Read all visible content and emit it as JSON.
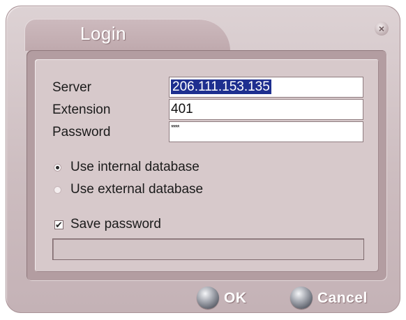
{
  "window": {
    "title": "Login",
    "close_icon": "close-icon"
  },
  "form": {
    "server_label": "Server",
    "server_value": "206.111.153.135",
    "extension_label": "Extension",
    "extension_value": "401",
    "password_label": "Password",
    "password_masked": "****"
  },
  "database": {
    "options": [
      {
        "label": "Use internal database",
        "selected": true
      },
      {
        "label": "Use external database",
        "selected": false
      }
    ]
  },
  "save_password": {
    "label": "Save password",
    "checked": true,
    "mark": "✔"
  },
  "status_text": "",
  "buttons": {
    "ok_label": "OK",
    "cancel_label": "Cancel"
  },
  "colors": {
    "selection": "#1e2f8f",
    "dialog_bg": "#d7c9cb",
    "orb": "#5b5f69"
  }
}
